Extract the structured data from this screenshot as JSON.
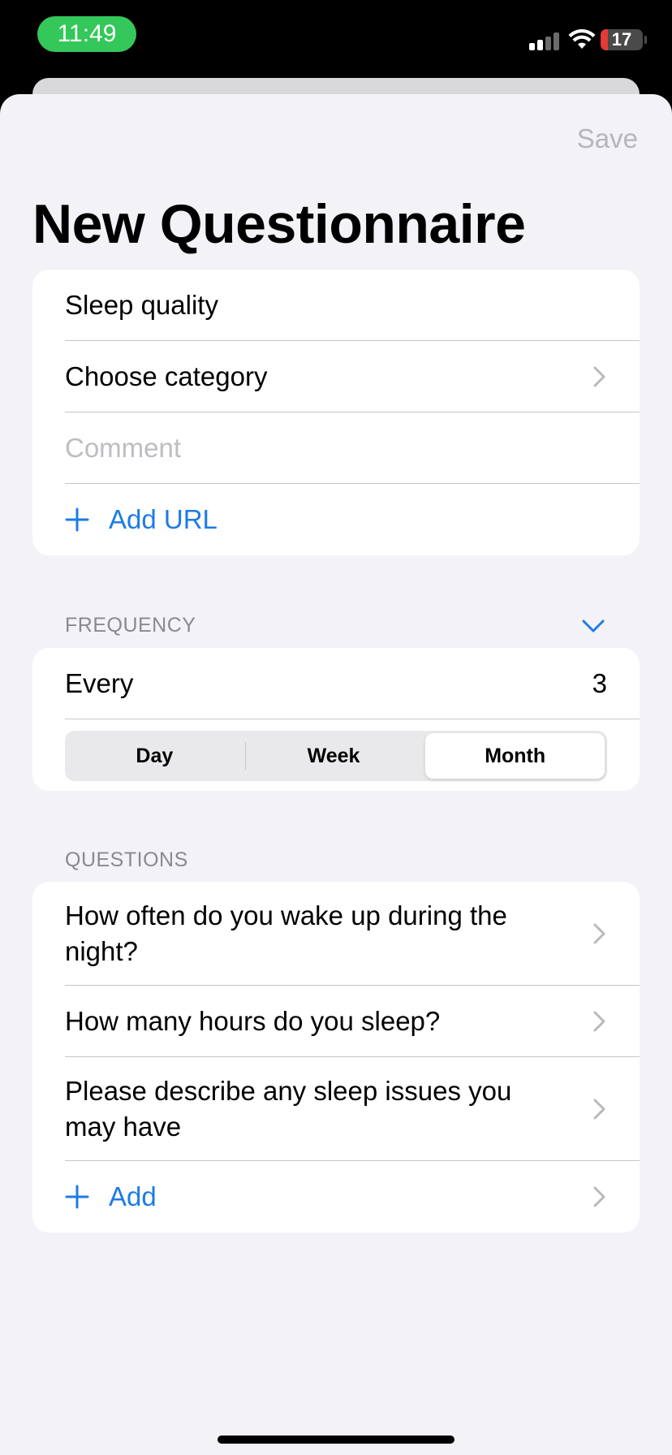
{
  "status_bar": {
    "time": "11:49",
    "battery_level": "17",
    "time_pill_color": "#34C759",
    "battery_color": "#E53935",
    "signal_bars_active": 2,
    "signal_bars_total": 4
  },
  "nav": {
    "save_label": "Save",
    "title": "New Questionnaire"
  },
  "details": {
    "name_value": "Sleep quality",
    "category_label": "Choose category",
    "comment_placeholder": "Comment",
    "add_url_label": "Add URL"
  },
  "frequency": {
    "header": "FREQUENCY",
    "every_label": "Every",
    "every_value": "3",
    "segments": [
      "Day",
      "Week",
      "Month"
    ],
    "selected_segment": "Month"
  },
  "questions": {
    "header": "QUESTIONS",
    "items": [
      "How often do you wake up during the night?",
      "How many hours do you sleep?",
      "Please describe any sleep issues you may have"
    ],
    "add_label": "Add"
  },
  "colors": {
    "accent": "#1E7BE6",
    "background": "#F2F2F7",
    "secondary_text": "#8A8A8E",
    "disabled_text": "#B5B5BA"
  },
  "icons": {
    "chevron": "chevron-right-icon",
    "plus": "plus-icon",
    "collapse": "chevron-down-icon"
  }
}
